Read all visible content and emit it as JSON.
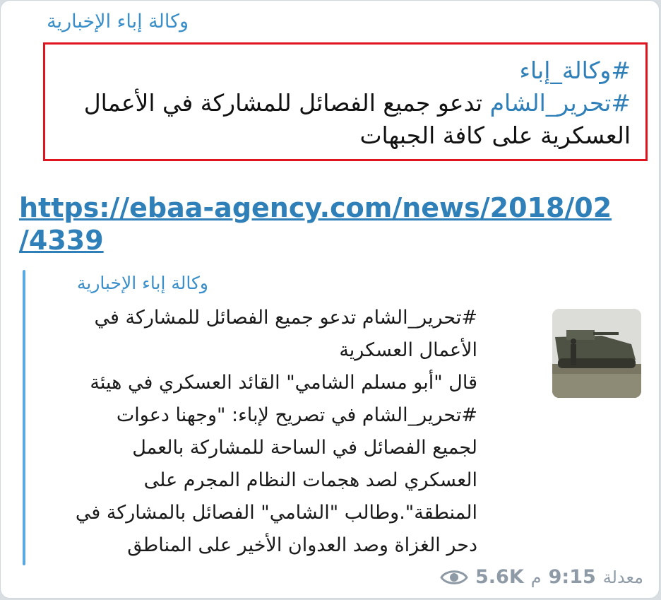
{
  "message": {
    "channel_name": "وكالة إباء الإخبارية",
    "hashtag_agency": "#وكالة_إباء",
    "hashtag_hts": "#تحرير_الشام",
    "text_line1_rest": " تدعو جميع الفصائل للمشاركة في الأعمال",
    "text_line2": "العسكرية على كافة الجبهات",
    "link_line1": "https://ebaa-agency.com/news/2018/02",
    "link_line2": "/4339"
  },
  "preview": {
    "site_name": "وكالة إباء الإخبارية",
    "lines": [
      "#تحرير_الشام تدعو جميع الفصائل للمشاركة في",
      "الأعمال العسكرية",
      "قال \"أبو مسلم الشامي\" القائد العسكري في هيئة",
      "#تحرير_الشام في تصريح لإباء: \"وجهنا دعوات",
      "لجميع الفصائل في الساحة للمشاركة بالعمل",
      "العسكري لصد هجمات النظام المجرم على",
      "المنطقة\".وطالب \"الشامي\" الفصائل بالمشاركة في",
      "دحر الغزاة وصد العدوان الأخير على المناطق"
    ],
    "thumbnail_icon": "military-vehicle-photo"
  },
  "footer": {
    "edited_label": "معدلة",
    "time": "9:15",
    "meridiem": "م",
    "views": "5.6K",
    "views_icon": "eye-icon"
  },
  "colors": {
    "link": "#2f7fb8",
    "channel": "#3b8fc9",
    "highlight_border": "#e0141e",
    "preview_bar": "#5aa8df",
    "meta": "#8e9aa5"
  }
}
